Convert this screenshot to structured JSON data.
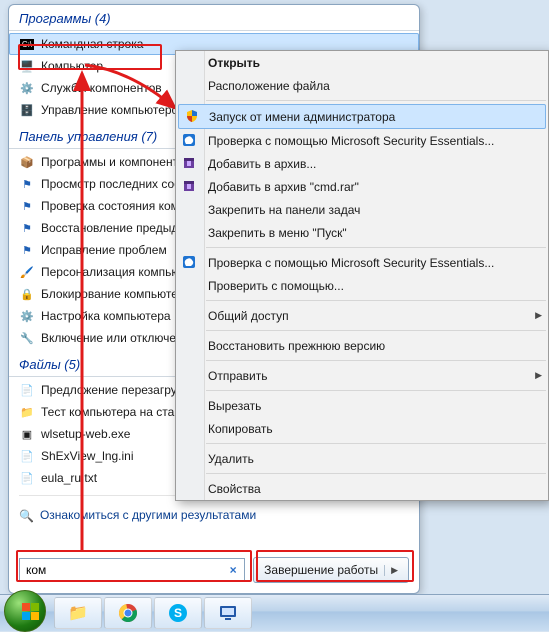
{
  "sections": {
    "programs_header": "Программы (4)",
    "control_panel_header": "Панель управления (7)",
    "files_header": "Файлы (5)"
  },
  "programs": [
    {
      "label": "Командная строка",
      "icon": "cmd"
    },
    {
      "label": "Компьютер",
      "icon": "pc"
    },
    {
      "label": "Службы компонентов",
      "icon": "svc"
    },
    {
      "label": "Управление компьютером",
      "icon": "mgmt"
    }
  ],
  "control_panel": [
    {
      "label": "Программы и компоненты",
      "icon": "prog"
    },
    {
      "label": "Просмотр последних сообщений",
      "icon": "flag"
    },
    {
      "label": "Проверка состояния компьютера",
      "icon": "flag"
    },
    {
      "label": "Восстановление предыдущего состояния",
      "icon": "flag"
    },
    {
      "label": "Исправление проблем",
      "icon": "flag"
    },
    {
      "label": "Персонализация компьютера",
      "icon": "pers"
    },
    {
      "label": "Блокирование компьютера",
      "icon": "lock"
    },
    {
      "label": "Настройка компьютера",
      "icon": "gear"
    },
    {
      "label": "Включение или отключение",
      "icon": "feat"
    }
  ],
  "files": [
    {
      "label": "Предложение перезагрузить",
      "icon": "doc"
    },
    {
      "label": "Тест компьютера на стабильность",
      "icon": "folder"
    },
    {
      "label": "wlsetup-web.exe",
      "icon": "exe"
    },
    {
      "label": "ShExView_lng.ini",
      "icon": "ini"
    },
    {
      "label": "eula_ru.txt",
      "icon": "txt"
    }
  ],
  "more_results": "Ознакомиться с другими результатами",
  "search": {
    "value": "ком",
    "clear": "×"
  },
  "shutdown_label": "Завершение работы",
  "context_menu": [
    {
      "label": "Открыть",
      "bold": true
    },
    {
      "label": "Расположение файла"
    },
    {
      "sep": true
    },
    {
      "label": "Запуск от имени администратора",
      "icon": "shield",
      "selected": true
    },
    {
      "label": "Проверка с помощью Microsoft Security Essentials...",
      "icon": "mse"
    },
    {
      "label": "Добавить в архив...",
      "icon": "rar"
    },
    {
      "label": "Добавить в архив \"cmd.rar\"",
      "icon": "rar"
    },
    {
      "label": "Закрепить на панели задач"
    },
    {
      "label": "Закрепить в меню \"Пуск\""
    },
    {
      "sep": true
    },
    {
      "label": "Проверка с помощью Microsoft Security Essentials...",
      "icon": "mse"
    },
    {
      "label": "Проверить с помощью..."
    },
    {
      "sep": true
    },
    {
      "label": "Общий доступ",
      "sub": true
    },
    {
      "sep": true
    },
    {
      "label": "Восстановить прежнюю версию"
    },
    {
      "sep": true
    },
    {
      "label": "Отправить",
      "sub": true
    },
    {
      "sep": true
    },
    {
      "label": "Вырезать"
    },
    {
      "label": "Копировать"
    },
    {
      "sep": true
    },
    {
      "label": "Удалить"
    },
    {
      "sep": true
    },
    {
      "label": "Свойства"
    }
  ]
}
